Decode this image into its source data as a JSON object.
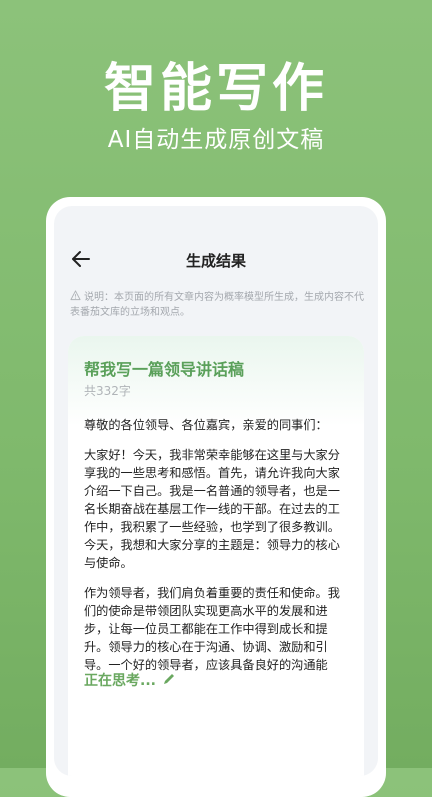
{
  "hero": {
    "title": "智能写作",
    "subtitle": "AI自动生成原创文稿"
  },
  "header": {
    "title": "生成结果",
    "back_icon": "arrow-left-icon"
  },
  "notice": {
    "icon": "warning-triangle-icon",
    "text": "说明：本页面的所有文章内容为概率模型所生成，生成内容不代表番茄文库的立场和观点。"
  },
  "card": {
    "title": "帮我写一篇领导讲话稿",
    "word_count": "共332字",
    "paragraphs": [
      "尊敬的各位领导、各位嘉宾，亲爱的同事们：",
      "大家好！今天，我非常荣幸能够在这里与大家分享我的一些思考和感悟。首先，请允许我向大家介绍一下自己。我是一名普通的领导者，也是一名长期奋战在基层工作一线的干部。在过去的工作中，我积累了一些经验，也学到了很多教训。今天，我想和大家分享的主题是：领导力的核心与使命。",
      "作为领导者，我们肩负着重要的责任和使命。我们的使命是带领团队实现更高水平的发展和进步，让每一位员工都能在工作中得到成长和提升。领导力的核心在于沟通、协调、激励和引导。一个好的领导者，应该具备良好的沟通能"
    ],
    "status": "正在思考...",
    "status_icon": "pencil-icon"
  },
  "colors": {
    "background": "#7fb96c",
    "accent": "#5aa05a"
  }
}
